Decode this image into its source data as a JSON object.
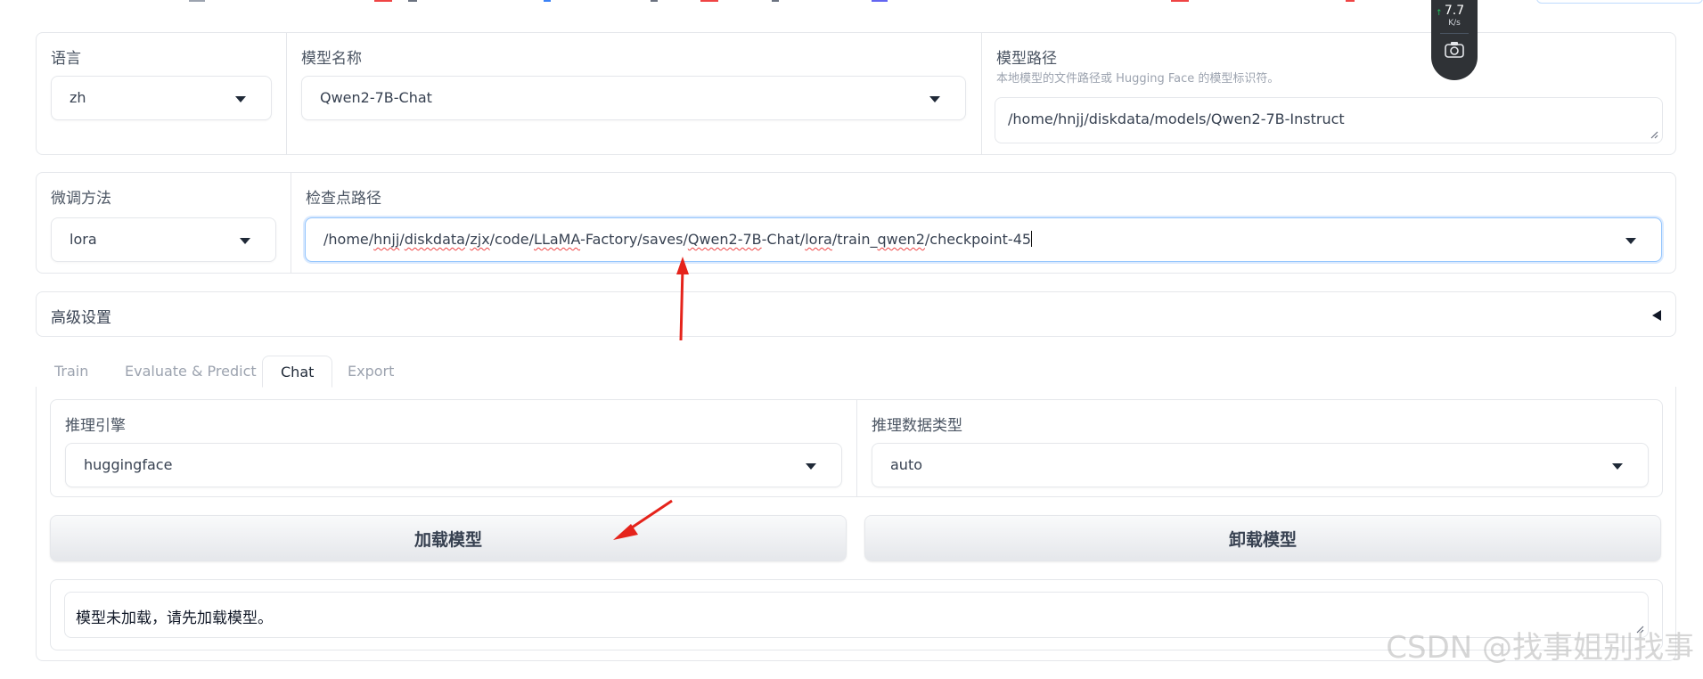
{
  "model_config": {
    "language": {
      "label": "语言",
      "value": "zh"
    },
    "model_name": {
      "label": "模型名称",
      "value": "Qwen2-7B-Chat"
    },
    "model_path": {
      "label": "模型路径",
      "hint": "本地模型的文件路径或 Hugging Face 的模型标识符。",
      "value": "/home/hnjj/diskdata/models/Qwen2-7B-Instruct"
    }
  },
  "finetune": {
    "method": {
      "label": "微调方法",
      "value": "lora"
    },
    "checkpoint": {
      "label": "检查点路径",
      "segments": [
        "/home/",
        "hnjj",
        "/",
        "diskdata",
        "/",
        "zjx",
        "/code/",
        "LLaMA",
        "-Factory/saves/",
        "Qwen2-7B",
        "-Chat/",
        "lora",
        "/train_",
        "qwen2",
        "/checkpoint-45"
      ]
    }
  },
  "advanced": {
    "label": "高级设置"
  },
  "tabs": [
    {
      "label": "Train",
      "active": false
    },
    {
      "label": "Evaluate & Predict",
      "active": false
    },
    {
      "label": "Chat",
      "active": true
    },
    {
      "label": "Export",
      "active": false
    }
  ],
  "chat": {
    "infer_backend": {
      "label": "推理引擎",
      "value": "huggingface"
    },
    "infer_dtype": {
      "label": "推理数据类型",
      "value": "auto"
    },
    "load_button": "加载模型",
    "unload_button": "卸载模型",
    "info_box": "模型未加载，请先加载模型。"
  },
  "net_widget": {
    "speed": "7.7",
    "unit": "K/s",
    "up_symbol": "↑"
  },
  "watermark": "CSDN @找事姐别找事",
  "colors": {
    "arrow": "#e5231b",
    "focus": "#93c5fd",
    "typo_underline": "#ef4444"
  }
}
